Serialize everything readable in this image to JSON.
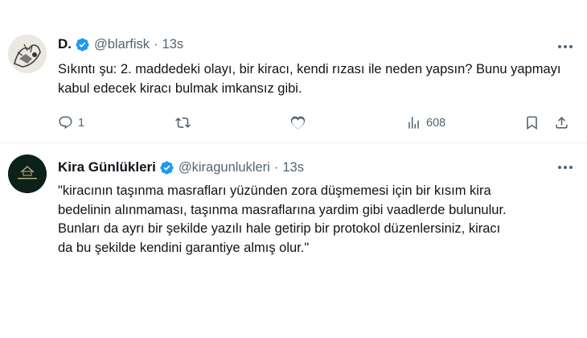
{
  "tweets": [
    {
      "author_name": "D.",
      "handle": "@blarfisk",
      "separator": "·",
      "time": "13s",
      "text": "Sıkıntı şu: 2. maddedeki olayı, bir kiracı, kendi rızası ile neden yapsın? Bunu yapmayı kabul edecek kiracı bulmak imkansız gibi.",
      "reply_count": "1",
      "views": "608"
    },
    {
      "author_name": "Kira Günlükleri",
      "handle": "@kiragunlukleri",
      "separator": "·",
      "time": "13s",
      "text": "\"kiracının taşınma masrafları yüzünden zora düşmemesi için bir kısım kira bedelinin alınmaması, taşınma masraflarına yardim gibi vaadlerde bulunulur. Bunları da ayrı bir şekilde yazılı hale getirip bir protokol düzenlersiniz, kiracı da bu şekilde kendini garantiye almış olur.\""
    }
  ],
  "colors": {
    "accent": "#1d9bf0",
    "text": "#0f1419",
    "muted": "#536471"
  },
  "icons": [
    "verified-badge-icon",
    "more-icon",
    "reply-icon",
    "retweet-icon",
    "like-icon",
    "views-icon",
    "bookmark-icon",
    "share-icon"
  ]
}
